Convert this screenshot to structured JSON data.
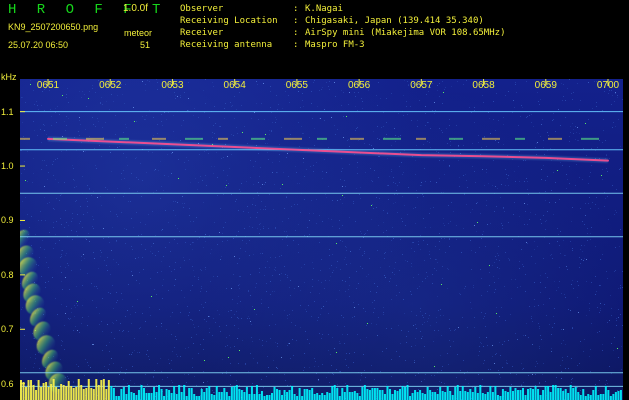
{
  "header": {
    "brand": "H R O F F T",
    "version": "1.0.0f",
    "filename": "KN9_2507200650.png",
    "mode": "meteor",
    "timestamp": "25.07.20 06:50",
    "count": "51"
  },
  "info": {
    "rows": [
      {
        "label": "Observer",
        "sep": ":",
        "value": "K.Nagai"
      },
      {
        "label": "Receiving Location",
        "sep": ":",
        "value": "Chigasaki, Japan (139.414 35.340)"
      },
      {
        "label": "Receiver",
        "sep": ":",
        "value": "AirSpy mini (Miakejima VOR 108.65MHz)"
      },
      {
        "label": "Receiving antenna",
        "sep": ":",
        "value": "Maspro FM-3"
      }
    ]
  },
  "chart_data": {
    "type": "heatmap",
    "ylabel": "kHz",
    "x": [
      "0651",
      "0652",
      "0653",
      "0654",
      "0655",
      "0656",
      "0657",
      "0658",
      "0659",
      "0700"
    ],
    "yticks": [
      "1.1",
      "1.0",
      "0.9",
      "0.8",
      "0.7",
      "0.6"
    ],
    "ylim": [
      0.57,
      1.16
    ],
    "series": [
      {
        "values": [
          {
            "x": 0,
            "y": 1.05
          },
          {
            "x": 1,
            "y": 1.045
          },
          {
            "x": 2,
            "y": 1.04
          },
          {
            "x": 3,
            "y": 1.035
          },
          {
            "x": 4,
            "y": 1.03
          },
          {
            "x": 5,
            "y": 1.025
          },
          {
            "x": 6,
            "y": 1.02
          },
          {
            "x": 7,
            "y": 1.018
          },
          {
            "x": 8,
            "y": 1.015
          },
          {
            "x": 9,
            "y": 1.01
          }
        ]
      },
      {
        "values": [
          {
            "x": 0,
            "y": 1.1
          },
          {
            "x": 9,
            "y": 1.1
          }
        ]
      },
      {
        "values": [
          {
            "x": 0,
            "y": 1.03
          },
          {
            "x": 9,
            "y": 1.03
          }
        ]
      },
      {
        "values": [
          {
            "x": 0,
            "y": 0.95
          },
          {
            "x": 9,
            "y": 0.95
          }
        ]
      },
      {
        "values": [
          {
            "x": 0,
            "y": 0.87
          },
          {
            "x": 9,
            "y": 0.87
          }
        ]
      },
      {
        "values": [
          {
            "x": 0,
            "y": 0.62
          },
          {
            "x": 9,
            "y": 0.62
          }
        ]
      },
      {
        "values": [
          {
            "x": 0,
            "y": 0.595
          },
          {
            "x": 9,
            "y": 0.595
          }
        ]
      }
    ],
    "grid": true
  },
  "colors": {
    "background": "#000000",
    "plot_background": "#13218c",
    "text_yellow": "#f2ef3a",
    "brand_green": "#16d51b",
    "trace_main": "#ff4f8f",
    "trace_secondary": "#7ad7ff",
    "noise_low": "#2f53bc",
    "noise_high": "#5eff63",
    "bottom_band": "#00f7ff",
    "tick_marks": "#f2ef3a"
  }
}
